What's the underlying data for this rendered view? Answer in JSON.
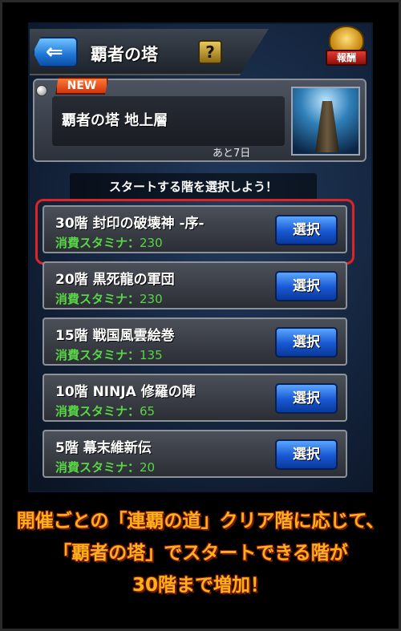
{
  "header": {
    "back_icon": "back-arrow-icon",
    "back_arrow": "⇐",
    "title": "覇者の塔",
    "help_label": "?",
    "reward_label": "報酬"
  },
  "tower": {
    "new_label": "NEW",
    "name": "覇者の塔 地上層",
    "days_left": "あと7日"
  },
  "instruction": "スタートする階を選択しよう！",
  "floors": [
    {
      "title": "30階 封印の破壊神 -序-",
      "stamina_label": "消費スタミナ：",
      "stamina": "230",
      "button": "選択",
      "highlighted": true
    },
    {
      "title": "20階 黒死龍の軍団",
      "stamina_label": "消費スタミナ：",
      "stamina": "230",
      "button": "選択"
    },
    {
      "title": "15階 戦国風雲絵巻",
      "stamina_label": "消費スタミナ：",
      "stamina": "135",
      "button": "選択"
    },
    {
      "title": "10階 NINJA 修羅の陣",
      "stamina_label": "消費スタミナ：",
      "stamina": "65",
      "button": "選択"
    },
    {
      "title": "5階 幕末維新伝",
      "stamina_label": "消費スタミナ：",
      "stamina": "20",
      "button": "選択"
    }
  ],
  "caption": {
    "line1": "開催ごとの「連覇の道」クリア階に応じて、",
    "line2": "「覇者の塔」でスタートできる階が",
    "line3": "30階まで増加！"
  },
  "colors": {
    "highlight": "#e02424",
    "stamina": "#58d646",
    "caption": "#ffb019",
    "select_button": "#1757d1"
  }
}
